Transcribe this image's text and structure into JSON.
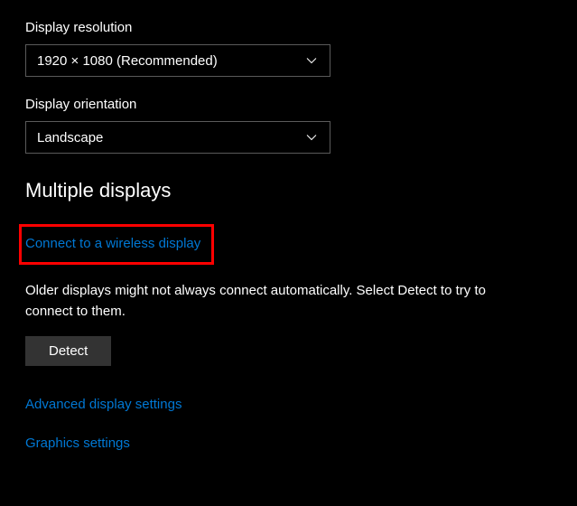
{
  "resolution": {
    "label": "Display resolution",
    "value": "1920 × 1080 (Recommended)"
  },
  "orientation": {
    "label": "Display orientation",
    "value": "Landscape"
  },
  "multiple": {
    "heading": "Multiple displays",
    "connect_link": "Connect to a wireless display",
    "older_displays_text": "Older displays might not always connect automatically. Select Detect to try to connect to them.",
    "detect_button": "Detect"
  },
  "links": {
    "advanced": "Advanced display settings",
    "graphics": "Graphics settings"
  }
}
